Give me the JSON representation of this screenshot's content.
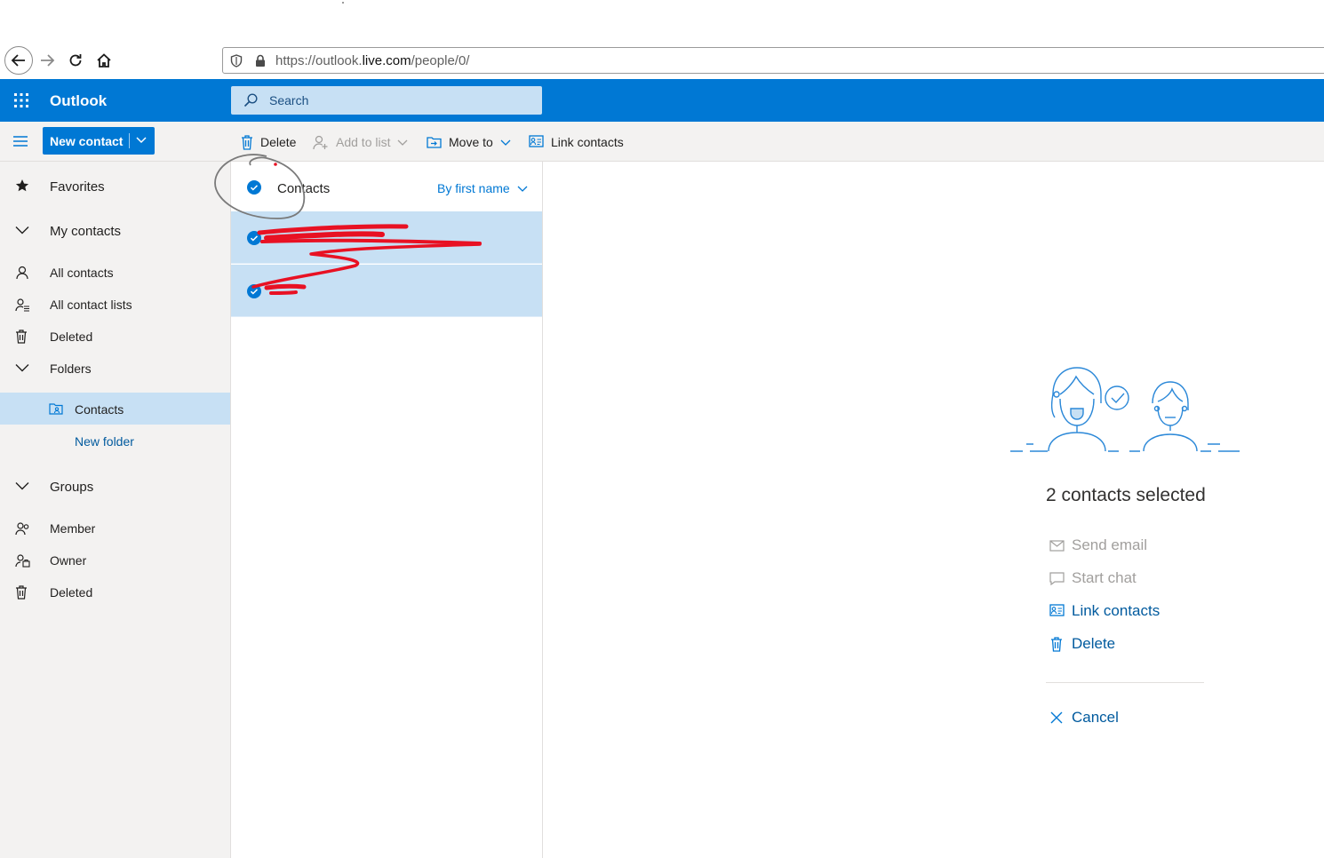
{
  "browser": {
    "url": "https://outlook.live.com/people/0/",
    "url_prefix": "https://outlook.",
    "url_domain": "live.com",
    "url_path": "/people/0/"
  },
  "app": {
    "brand": "Outlook",
    "search_placeholder": "Search"
  },
  "toolbar": {
    "new_contact": "New contact",
    "delete": "Delete",
    "add_to_list": "Add to list",
    "move_to": "Move to",
    "link_contacts": "Link contacts"
  },
  "sidebar": {
    "favorites": "Favorites",
    "my_contacts": "My contacts",
    "all_contacts": "All contacts",
    "all_contact_lists": "All contact lists",
    "deleted": "Deleted",
    "folders": "Folders",
    "contacts": "Contacts",
    "new_folder": "New folder",
    "groups": "Groups",
    "member": "Member",
    "owner": "Owner",
    "groups_deleted": "Deleted"
  },
  "list": {
    "title": "Contacts",
    "sort": "By first name",
    "rows_selected": [
      true,
      true
    ]
  },
  "reading": {
    "selected_text": "2 contacts selected",
    "send_email": "Send email",
    "start_chat": "Start chat",
    "link_contacts": "Link contacts",
    "delete": "Delete",
    "cancel": "Cancel"
  },
  "colors": {
    "accent": "#0078d4",
    "selected_bg": "#c7e0f4",
    "annotation_red": "#e81123",
    "annotation_gray": "#7a7a7a"
  }
}
